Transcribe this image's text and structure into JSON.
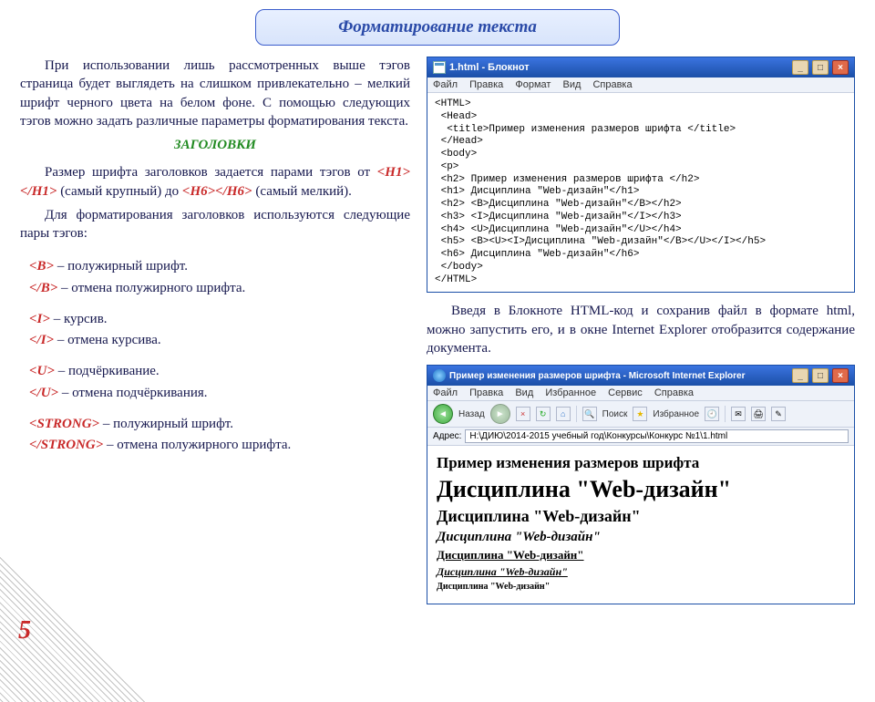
{
  "title": "Форматирование текста",
  "page_number": "5",
  "left": {
    "p1": "При использовании лишь рассмотренных выше тэгов страница будет выглядеть на слишком привлекательно – мелкий шрифт черного цвета на белом фоне. С помощью следующих тэгов можно задать различные параметры форматирования текста.",
    "heading": "ЗАГОЛОВКИ",
    "p2a": "Размер шрифта заголовков задается парами тэгов от ",
    "t_h1": "<H1></H1>",
    "p2b": " (самый крупный) до ",
    "t_h6": "<H6></H6>",
    "p2c": "  (самый мелкий).",
    "p3": "Для форматирования заголовков используются следующие  пары тэгов:",
    "tags": {
      "b_open": "<B>",
      "b_open_d": " – полужирный шрифт.",
      "b_close": "</B>",
      "b_close_d": " – отмена полужирного шрифта.",
      "i_open": "<I>",
      "i_open_d": " – курсив.",
      "i_close": "</I>",
      "i_close_d": " – отмена курсива.",
      "u_open": "<U>",
      "u_open_d": " – подчёркивание.",
      "u_close": "</U>",
      "u_close_d": " – отмена подчёркивания.",
      "s_open": "<STRONG>",
      "s_open_d": " – полужирный шрифт.",
      "s_close": "</STRONG>",
      "s_close_d": " –  отмена полужирного шрифта."
    }
  },
  "notepad": {
    "title": "1.html - Блокнот",
    "menu": {
      "file": "Файл",
      "edit": "Правка",
      "format": "Формат",
      "view": "Вид",
      "help": "Справка"
    },
    "code": "<HTML>\n <Head>\n  <title>Пример изменения размеров шрифта </title>\n </Head>\n <body>\n <p>\n <h2> Пример изменения размеров шрифта </h2>\n <h1> Дисциплина \"Web-дизайн\"</h1>\n <h2> <B>Дисциплина \"Web-дизайн\"</B></h2>\n <h3> <I>Дисциплина \"Web-дизайн\"</I></h3>\n <h4> <U>Дисциплина \"Web-дизайн\"</U></h4>\n <h5> <B><U><I>Дисциплина \"Web-дизайн\"</B></U></I></h5>\n <h6> Дисциплина \"Web-дизайн\"</h6>\n </body>\n</HTML>"
  },
  "right_text": "Введя в Блокноте HTML-код  и сохранив файл в формате html, можно запустить его, и в окне Internet Explorer отобразится содержание документа.",
  "ie": {
    "title": "Пример изменения размеров шрифта - Microsoft Internet Explorer",
    "menu": {
      "file": "Файл",
      "edit": "Правка",
      "view": "Вид",
      "fav": "Избранное",
      "tools": "Сервис",
      "help": "Справка"
    },
    "toolbar": {
      "back": "Назад",
      "search": "Поиск",
      "fav": "Избранное"
    },
    "addr_label": "Адрес:",
    "address": "H:\\ДИЮ\\2014-2015 учебный год\\Конкурсы\\Конкурс №1\\1.html",
    "lines": {
      "h2head": "Пример изменения размеров шрифта",
      "h1": "Дисциплина \"Web-дизайн\"",
      "h2b": "Дисциплина \"Web-дизайн\"",
      "h3i": "Дисциплина \"Web-дизайн\"",
      "h4u": "Дисциплина \"Web-дизайн\"",
      "h5": "Дисциплина \"Web-дизайн\"",
      "h6": "Дисциплина \"Web-дизайн\""
    }
  }
}
